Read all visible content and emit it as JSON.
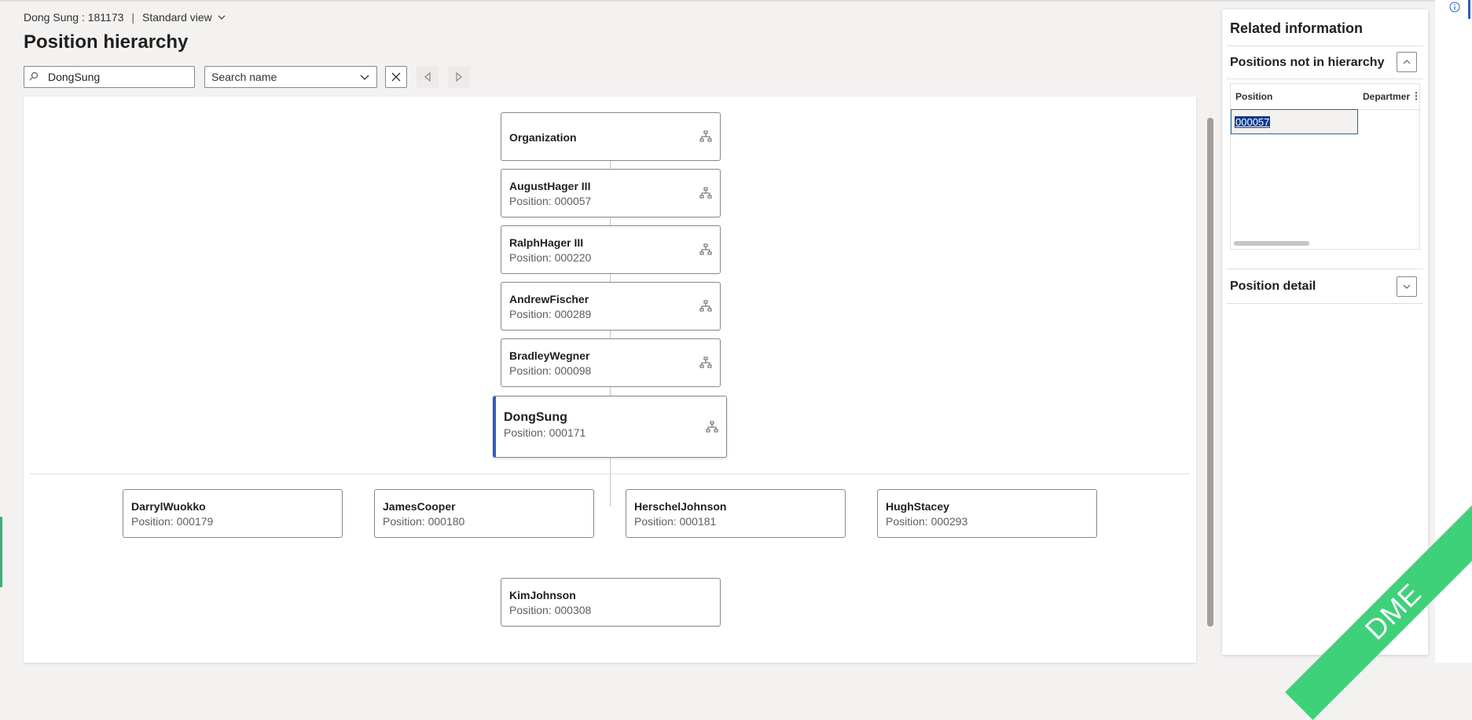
{
  "header": {
    "record": "Dong Sung : 181173",
    "separator": "|",
    "view_label": "Standard view",
    "page_title": "Position hierarchy"
  },
  "toolbar": {
    "search_value": "DongSung",
    "search_field_select": "Search name"
  },
  "hierarchy": {
    "chain": [
      {
        "name": "Organization",
        "position": ""
      },
      {
        "name": "AugustHager III",
        "position": "Position: 000057"
      },
      {
        "name": "RalphHager III",
        "position": "Position: 000220"
      },
      {
        "name": "AndrewFischer",
        "position": "Position: 000289"
      },
      {
        "name": "BradleyWegner",
        "position": "Position: 000098"
      }
    ],
    "selected": {
      "name": "DongSung",
      "position": "Position: 000171"
    },
    "reports": [
      {
        "name": "DarrylWuokko",
        "position": "Position: 000179"
      },
      {
        "name": "JamesCooper",
        "position": "Position: 000180"
      },
      {
        "name": "HerschelJohnson",
        "position": "Position: 000181"
      },
      {
        "name": "HughStacey",
        "position": "Position: 000293"
      },
      {
        "name": "KimJohnson",
        "position": "Position: 000308"
      }
    ]
  },
  "related": {
    "title": "Related information",
    "not_in_hierarchy": {
      "title": "Positions not in hierarchy",
      "columns": [
        "Position",
        "Departmer"
      ],
      "rows": [
        {
          "position": "000057",
          "department": ""
        }
      ]
    },
    "detail_title": "Position detail"
  },
  "watermark": "DME",
  "colors": {
    "accent": "#2e5dc8",
    "selection": "#0f3b8c",
    "ribbon": "#3fd07a"
  }
}
